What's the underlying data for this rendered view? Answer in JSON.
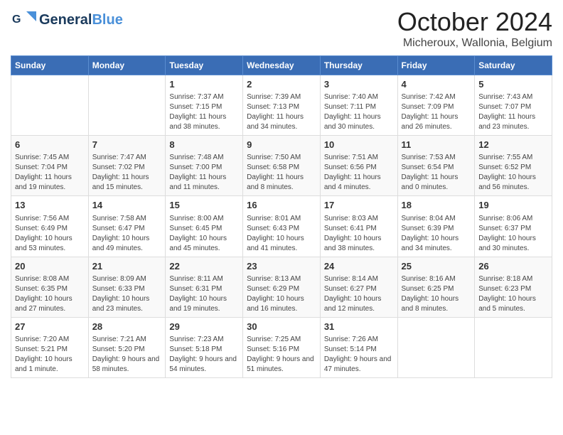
{
  "logo": {
    "line1": "General",
    "line2": "Blue",
    "icon_color": "#4a90d9"
  },
  "title": "October 2024",
  "subtitle": "Micheroux, Wallonia, Belgium",
  "days_of_week": [
    "Sunday",
    "Monday",
    "Tuesday",
    "Wednesday",
    "Thursday",
    "Friday",
    "Saturday"
  ],
  "weeks": [
    [
      {
        "day": "",
        "info": ""
      },
      {
        "day": "",
        "info": ""
      },
      {
        "day": "1",
        "info": "Sunrise: 7:37 AM\nSunset: 7:15 PM\nDaylight: 11 hours and 38 minutes."
      },
      {
        "day": "2",
        "info": "Sunrise: 7:39 AM\nSunset: 7:13 PM\nDaylight: 11 hours and 34 minutes."
      },
      {
        "day": "3",
        "info": "Sunrise: 7:40 AM\nSunset: 7:11 PM\nDaylight: 11 hours and 30 minutes."
      },
      {
        "day": "4",
        "info": "Sunrise: 7:42 AM\nSunset: 7:09 PM\nDaylight: 11 hours and 26 minutes."
      },
      {
        "day": "5",
        "info": "Sunrise: 7:43 AM\nSunset: 7:07 PM\nDaylight: 11 hours and 23 minutes."
      }
    ],
    [
      {
        "day": "6",
        "info": "Sunrise: 7:45 AM\nSunset: 7:04 PM\nDaylight: 11 hours and 19 minutes."
      },
      {
        "day": "7",
        "info": "Sunrise: 7:47 AM\nSunset: 7:02 PM\nDaylight: 11 hours and 15 minutes."
      },
      {
        "day": "8",
        "info": "Sunrise: 7:48 AM\nSunset: 7:00 PM\nDaylight: 11 hours and 11 minutes."
      },
      {
        "day": "9",
        "info": "Sunrise: 7:50 AM\nSunset: 6:58 PM\nDaylight: 11 hours and 8 minutes."
      },
      {
        "day": "10",
        "info": "Sunrise: 7:51 AM\nSunset: 6:56 PM\nDaylight: 11 hours and 4 minutes."
      },
      {
        "day": "11",
        "info": "Sunrise: 7:53 AM\nSunset: 6:54 PM\nDaylight: 11 hours and 0 minutes."
      },
      {
        "day": "12",
        "info": "Sunrise: 7:55 AM\nSunset: 6:52 PM\nDaylight: 10 hours and 56 minutes."
      }
    ],
    [
      {
        "day": "13",
        "info": "Sunrise: 7:56 AM\nSunset: 6:49 PM\nDaylight: 10 hours and 53 minutes."
      },
      {
        "day": "14",
        "info": "Sunrise: 7:58 AM\nSunset: 6:47 PM\nDaylight: 10 hours and 49 minutes."
      },
      {
        "day": "15",
        "info": "Sunrise: 8:00 AM\nSunset: 6:45 PM\nDaylight: 10 hours and 45 minutes."
      },
      {
        "day": "16",
        "info": "Sunrise: 8:01 AM\nSunset: 6:43 PM\nDaylight: 10 hours and 41 minutes."
      },
      {
        "day": "17",
        "info": "Sunrise: 8:03 AM\nSunset: 6:41 PM\nDaylight: 10 hours and 38 minutes."
      },
      {
        "day": "18",
        "info": "Sunrise: 8:04 AM\nSunset: 6:39 PM\nDaylight: 10 hours and 34 minutes."
      },
      {
        "day": "19",
        "info": "Sunrise: 8:06 AM\nSunset: 6:37 PM\nDaylight: 10 hours and 30 minutes."
      }
    ],
    [
      {
        "day": "20",
        "info": "Sunrise: 8:08 AM\nSunset: 6:35 PM\nDaylight: 10 hours and 27 minutes."
      },
      {
        "day": "21",
        "info": "Sunrise: 8:09 AM\nSunset: 6:33 PM\nDaylight: 10 hours and 23 minutes."
      },
      {
        "day": "22",
        "info": "Sunrise: 8:11 AM\nSunset: 6:31 PM\nDaylight: 10 hours and 19 minutes."
      },
      {
        "day": "23",
        "info": "Sunrise: 8:13 AM\nSunset: 6:29 PM\nDaylight: 10 hours and 16 minutes."
      },
      {
        "day": "24",
        "info": "Sunrise: 8:14 AM\nSunset: 6:27 PM\nDaylight: 10 hours and 12 minutes."
      },
      {
        "day": "25",
        "info": "Sunrise: 8:16 AM\nSunset: 6:25 PM\nDaylight: 10 hours and 8 minutes."
      },
      {
        "day": "26",
        "info": "Sunrise: 8:18 AM\nSunset: 6:23 PM\nDaylight: 10 hours and 5 minutes."
      }
    ],
    [
      {
        "day": "27",
        "info": "Sunrise: 7:20 AM\nSunset: 5:21 PM\nDaylight: 10 hours and 1 minute."
      },
      {
        "day": "28",
        "info": "Sunrise: 7:21 AM\nSunset: 5:20 PM\nDaylight: 9 hours and 58 minutes."
      },
      {
        "day": "29",
        "info": "Sunrise: 7:23 AM\nSunset: 5:18 PM\nDaylight: 9 hours and 54 minutes."
      },
      {
        "day": "30",
        "info": "Sunrise: 7:25 AM\nSunset: 5:16 PM\nDaylight: 9 hours and 51 minutes."
      },
      {
        "day": "31",
        "info": "Sunrise: 7:26 AM\nSunset: 5:14 PM\nDaylight: 9 hours and 47 minutes."
      },
      {
        "day": "",
        "info": ""
      },
      {
        "day": "",
        "info": ""
      }
    ]
  ]
}
